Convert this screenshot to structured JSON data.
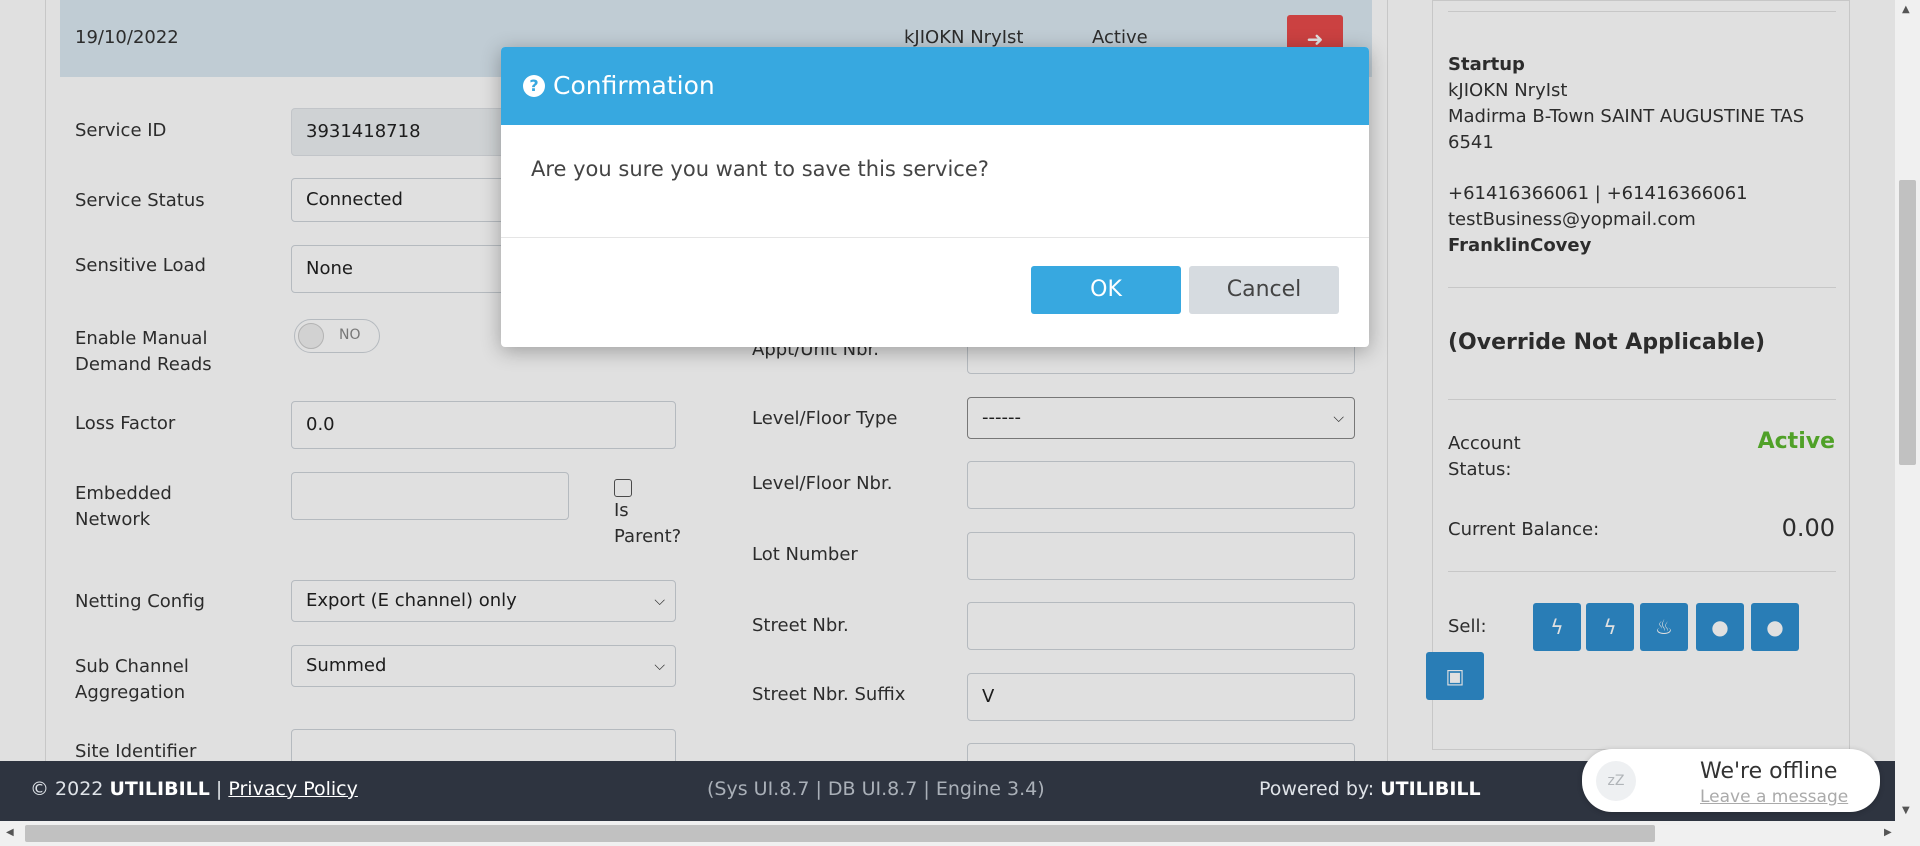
{
  "header_row": {
    "date": "19/10/2022",
    "name": "kJIOKN NryIst",
    "status": "Active"
  },
  "form": {
    "service_id_label": "Service ID",
    "service_id_value": "3931418718",
    "service_status_label": "Service Status",
    "service_status_value": "Connected",
    "sensitive_load_label": "Sensitive Load",
    "sensitive_load_value": "None",
    "manual_reads_label_1": "Enable Manual",
    "manual_reads_label_2": "Demand Reads",
    "manual_reads_toggle": "NO",
    "loss_factor_label": "Loss Factor",
    "loss_factor_value": "0.0",
    "embedded_label_1": "Embedded",
    "embedded_label_2": "Network",
    "is_parent_label_1": "Is",
    "is_parent_label_2": "Parent?",
    "netting_label": "Netting Config",
    "netting_value": "Export (E channel) only",
    "sub_channel_label_1": "Sub Channel",
    "sub_channel_label_2": "Aggregation",
    "sub_channel_value": "Summed",
    "site_identifier_label": "Site Identifier",
    "appt_unit_label": "Appt/Unit Nbr.",
    "level_type_label": "Level/Floor Type",
    "level_type_value": "------",
    "level_nbr_label": "Level/Floor Nbr.",
    "lot_number_label": "Lot Number",
    "street_nbr_label": "Street Nbr.",
    "street_suffix_label": "Street Nbr. Suffix",
    "street_suffix_value": "V"
  },
  "side": {
    "account_type": "Startup",
    "name": "kJIOKN NryIst",
    "address_1": "Madirma B-Town SAINT AUGUSTINE TAS",
    "address_2": "6541",
    "phones": "+61416366061 | +61416366061",
    "email": "testBusiness@yopmail.com",
    "company": "FranklinCovey",
    "override": "(Override Not Applicable)",
    "account_status_label_1": "Account",
    "account_status_label_2": "Status:",
    "account_status_value": "Active",
    "balance_label": "Current Balance:",
    "balance_value": "0.00",
    "sell_label": "Sell:",
    "status_color": "#5cb82e"
  },
  "modal": {
    "title": "Confirmation",
    "message": "Are you sure you want to save this service?",
    "ok_label": "OK",
    "cancel_label": "Cancel"
  },
  "footer": {
    "copyright": "© 2022",
    "brand": "UTILIBILL",
    "separator": "|",
    "privacy": "Privacy Policy",
    "versions": "(Sys UI.8.7 | DB UI.8.7 | Engine 3.4)",
    "powered_label": "Powered by:",
    "powered_brand": "UTILIBILL"
  },
  "chat": {
    "title": "We're offline",
    "link": "Leave a message"
  }
}
